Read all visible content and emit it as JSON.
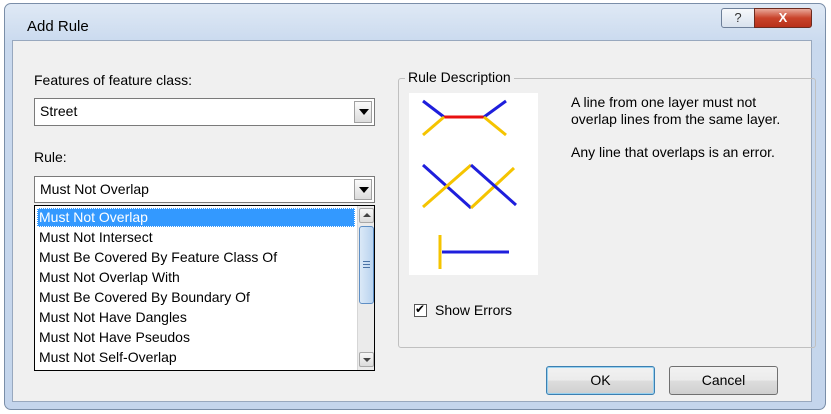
{
  "window": {
    "title": "Add Rule",
    "help": "?",
    "close": "X"
  },
  "features": {
    "label": "Features of feature class:",
    "value": "Street"
  },
  "rule": {
    "label": "Rule:",
    "value": "Must Not Overlap",
    "options": [
      "Must Not Overlap",
      "Must Not Intersect",
      "Must Be Covered By Feature Class Of",
      "Must Not Overlap With",
      "Must Be Covered By Boundary Of",
      "Must Not Have Dangles",
      "Must Not Have Pseudos",
      "Must Not Self-Overlap"
    ],
    "selected_index": 0
  },
  "description": {
    "title": "Rule Description",
    "text1": "A line from one layer must not overlap lines from the same layer.",
    "text2": "Any line that overlaps is an error."
  },
  "show_errors": {
    "label": "Show Errors",
    "checked": true
  },
  "buttons": {
    "ok": "OK",
    "cancel": "Cancel"
  },
  "colors": {
    "selection": "#3399ff",
    "line_blue": "#1e1edc",
    "line_yellow": "#f5c400",
    "error_red": "#e81010"
  }
}
